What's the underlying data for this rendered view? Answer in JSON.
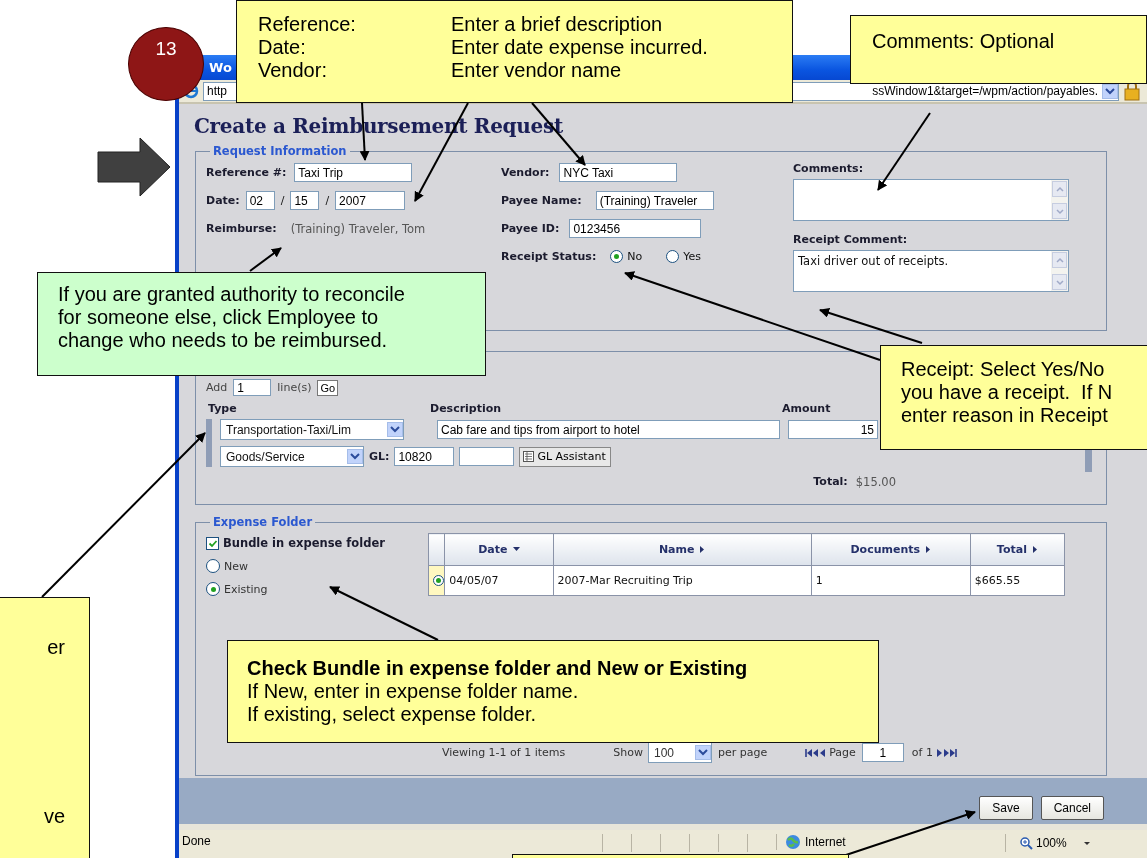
{
  "step_marker": {
    "number": "13"
  },
  "window": {
    "title": "Wo",
    "address_start": "http",
    "address_end": "ssWindow1&target=/wpm/action/payables."
  },
  "page": {
    "title": "Create a Reimbursement Request"
  },
  "request_information": {
    "legend": "Request Information",
    "reference": {
      "label": "Reference #:",
      "value": "Taxi Trip"
    },
    "date": {
      "label": "Date:",
      "month": "02",
      "day": "15",
      "year": "2007",
      "separators": [
        "/",
        "/"
      ]
    },
    "reimburse": {
      "label": "Reimburse:",
      "value": "(Training) Traveler, Tom"
    },
    "vendor": {
      "label": "Vendor:",
      "value": "NYC Taxi"
    },
    "payee_name": {
      "label": "Payee Name:",
      "value": "(Training) Traveler"
    },
    "payee_id": {
      "label": "Payee ID:",
      "value": "0123456"
    },
    "receipt_status": {
      "label": "Receipt Status:",
      "options": [
        {
          "label": "No",
          "selected": true
        },
        {
          "label": "Yes",
          "selected": false
        }
      ]
    },
    "comments": {
      "label": "Comments:"
    },
    "receipt_comment": {
      "label": "Receipt Comment:",
      "value": "Taxi driver out of receipts."
    }
  },
  "line_items": {
    "add_label": "Add",
    "add_count": "1",
    "add_unit": "line(s)",
    "go_button": "Go",
    "columns": [
      "Type",
      "Description",
      "Amount"
    ],
    "rows": [
      {
        "type": "Transportation-Taxi/Lim",
        "description": "Cab fare and tips from airport to hotel",
        "amount": "15",
        "category": "Goods/Service",
        "gl_label": "GL:",
        "gl_code": "10820",
        "gl_assistant": "GL Assistant"
      }
    ],
    "total_label": "Total:",
    "total": "$15.00"
  },
  "expense_folder": {
    "legend": "Expense Folder",
    "bundle": {
      "label": "Bundle in expense folder",
      "checked": true
    },
    "options": [
      {
        "label": "New",
        "selected": false
      },
      {
        "label": "Existing",
        "selected": true
      }
    ],
    "columns": [
      {
        "label": "Date",
        "sorted": true
      },
      {
        "label": "Name",
        "sorted": false
      },
      {
        "label": "Documents",
        "sorted": false
      },
      {
        "label": "Total",
        "sorted": false
      }
    ],
    "rows": [
      {
        "selected": true,
        "cells": [
          "04/05/07",
          "2007-Mar Recruiting Trip",
          "1",
          "$665.55"
        ]
      }
    ]
  },
  "pagination": {
    "viewing": "Viewing 1-1 of 1 items",
    "show_label": "Show",
    "page_size": "100",
    "per_page": "per page",
    "page_label": "Page",
    "page": "1",
    "of_pages": "of 1"
  },
  "buttons": [
    "Save",
    "Cancel"
  ],
  "status_bar": {
    "status": "Done",
    "zone": "Internet",
    "zoom": "100%"
  },
  "callouts": [
    {
      "kind": "rows",
      "color": "#ffff99",
      "rows": [
        {
          "label": "Reference:",
          "text": "Enter a brief description"
        },
        {
          "label": "Date:",
          "text": "Enter date expense incurred."
        },
        {
          "label": "Vendor:",
          "text": "Enter vendor name"
        }
      ]
    },
    {
      "kind": "lines",
      "color": "#ffff99",
      "lines": [
        "Comments: Optional"
      ]
    },
    {
      "kind": "lines",
      "color": "#ccffcc",
      "lines": [
        "If you are granted authority to reconcile",
        "for someone else, click Employee to",
        "change who needs to be reimbursed."
      ]
    },
    {
      "kind": "lines",
      "color": "#ffff99",
      "lines": [
        "Receipt: Select Yes/No",
        "you have a receipt.  If N",
        "enter reason in Receipt"
      ]
    },
    {
      "kind": "fragments",
      "color": "#ffff99",
      "lines": [
        "er",
        "ve"
      ]
    },
    {
      "kind": "lines",
      "color": "#ffff99",
      "heading": "Check Bundle in expense folder and New or Existing",
      "lines": [
        "If New, enter in expense folder name.",
        "If existing, select expense folder."
      ]
    },
    {
      "kind": "blank",
      "color": "#ffff99"
    }
  ]
}
